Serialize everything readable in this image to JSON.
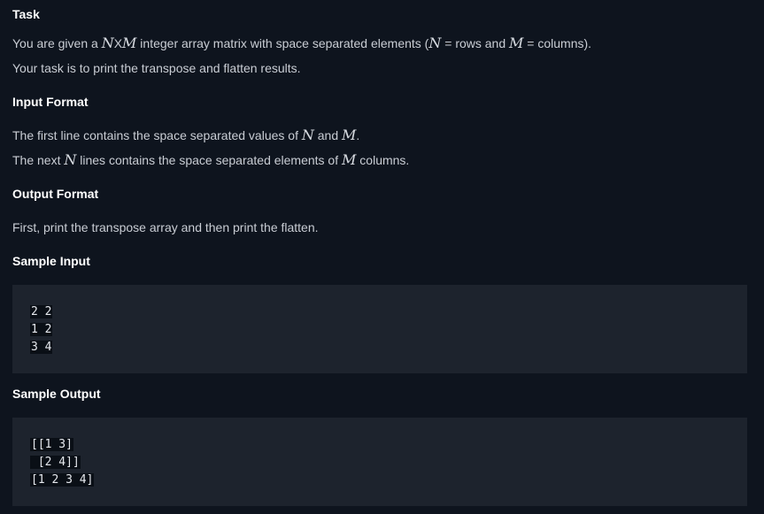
{
  "sections": {
    "task": {
      "heading": "Task",
      "line1_pre": "You are given a ",
      "line1_N": "N",
      "line1_x": "X",
      "line1_M": "M",
      "line1_mid": " integer array matrix with space separated elements (",
      "line1_N2": "N",
      "line1_rows": " = rows and ",
      "line1_M2": "M",
      "line1_end": " = columns).",
      "line2": "Your task is to print the transpose and flatten results."
    },
    "input_format": {
      "heading": "Input Format",
      "line1_pre": "The first line contains the space separated values of ",
      "line1_N": "N",
      "line1_and": " and ",
      "line1_M": "M",
      "line1_dot": ".",
      "line2_pre": "The next ",
      "line2_N": "N",
      "line2_mid": " lines contains the space separated elements of ",
      "line2_M": "M",
      "line2_end": " columns."
    },
    "output_format": {
      "heading": "Output Format",
      "line1": "First, print the transpose array and then print the flatten."
    },
    "sample_input": {
      "heading": "Sample Input",
      "lines": [
        "2 2",
        "1 2",
        "3 4"
      ]
    },
    "sample_output": {
      "heading": "Sample Output",
      "lines": [
        "[[1 3]",
        " [2 4]]",
        "[1 2 3 4]"
      ]
    }
  }
}
